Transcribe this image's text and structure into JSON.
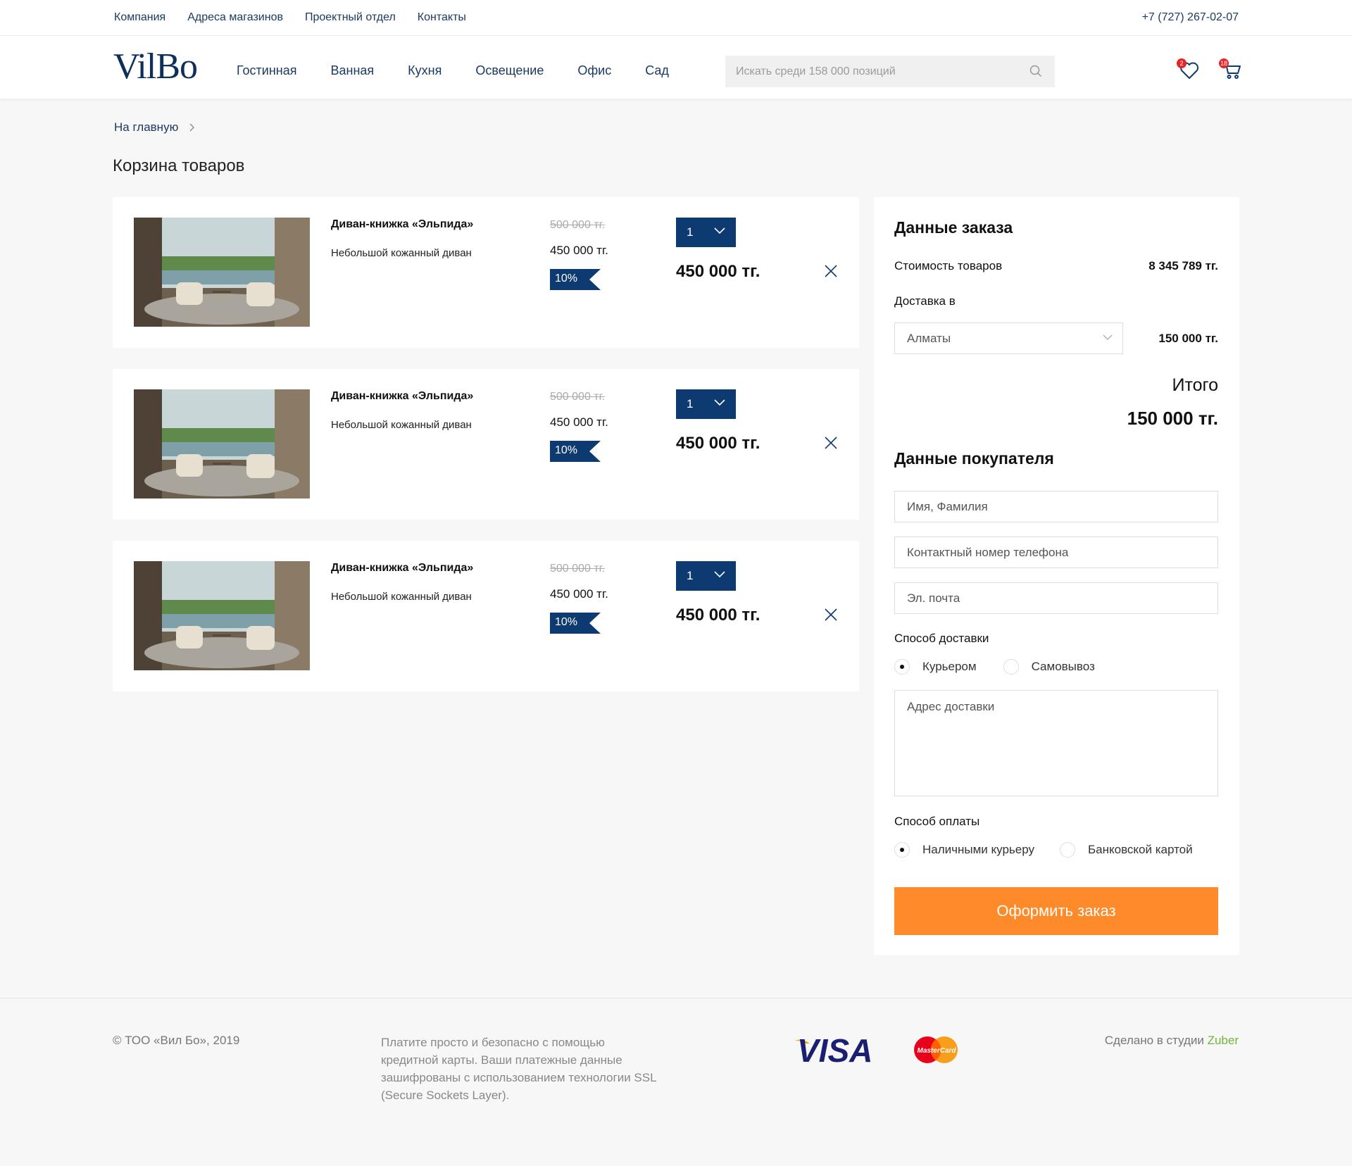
{
  "topbar": {
    "links": [
      "Компания",
      "Адреса магазинов",
      "Проектный отдел",
      "Контакты"
    ],
    "phone": "+7 (727) 267-02-07"
  },
  "header": {
    "logo": "VilBo",
    "nav": [
      "Гостинная",
      "Ванная",
      "Кухня",
      "Освещение",
      "Офис",
      "Сад"
    ],
    "search_placeholder": "Искать среди 158 000 позиций",
    "favorites_count": "2",
    "cart_count": "18"
  },
  "breadcrumb": {
    "home": "На главную"
  },
  "page_title": "Корзина товаров",
  "cart": {
    "items": [
      {
        "name": "Диван-книжка «Эльпида»",
        "desc": "Небольшой кожанный диван",
        "old_price": "500 000 тг.",
        "price": "450 000 тг.",
        "discount": "10%",
        "qty": "1",
        "total": "450 000 тг."
      },
      {
        "name": "Диван-книжка «Эльпида»",
        "desc": "Небольшой кожанный диван",
        "old_price": "500 000 тг.",
        "price": "450 000 тг.",
        "discount": "10%",
        "qty": "1",
        "total": "450 000 тг."
      },
      {
        "name": "Диван-книжка «Эльпида»",
        "desc": "Небольшой кожанный диван",
        "old_price": "500 000 тг.",
        "price": "450 000 тг.",
        "discount": "10%",
        "qty": "1",
        "total": "450 000 тг."
      }
    ]
  },
  "order": {
    "title": "Данные заказа",
    "goods_label": "Стоимость товаров",
    "goods_value": "8 345 789 тг.",
    "delivery_label": "Доставка в",
    "city": "Алматы",
    "delivery_value": "150 000 тг.",
    "total_label": "Итого",
    "total_value": "150 000 тг."
  },
  "buyer": {
    "title": "Данные покупателя",
    "name_placeholder": "Имя, Фамилия",
    "phone_placeholder": "Контактный номер телефона",
    "email_placeholder": "Эл. почта",
    "delivery_method_label": "Способ доставки",
    "delivery_options": [
      "Курьером",
      "Самовывоз"
    ],
    "address_placeholder": "Адрес доставки",
    "payment_method_label": "Способ оплаты",
    "payment_options": [
      "Наличными курьеру",
      "Банковской картой"
    ],
    "submit": "Оформить заказ"
  },
  "footer": {
    "copyright": "© ТОО «Вил Бо», 2019",
    "payment_text": "Платите просто и безопасно с помощью кредитной карты. Ваши платежные данные зашифрованы с использованием технологии SSL (Secure Sockets Layer).",
    "visa": "VISA",
    "mastercard": "MasterCard",
    "studio_prefix": "Сделано в студии ",
    "studio_name": "Zuber"
  },
  "colors": {
    "brand_navy": "#0e3a72",
    "accent_orange": "#ff8a2a",
    "badge_red": "#e42626",
    "studio_green": "#72b33a"
  }
}
